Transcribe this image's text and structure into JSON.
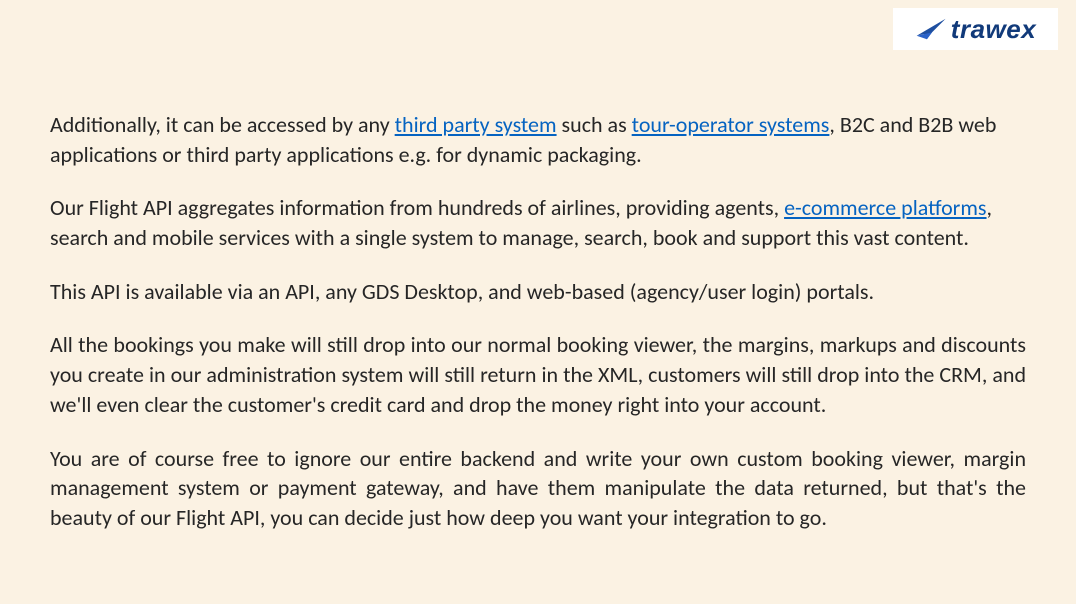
{
  "logo": {
    "brand": "trawex",
    "accent": "#113a7a"
  },
  "paragraphs": [
    {
      "justify": false,
      "segments": [
        {
          "type": "text",
          "text": "Additionally, it can be accessed by any "
        },
        {
          "type": "link",
          "text": "third party system"
        },
        {
          "type": "text",
          "text": " such as "
        },
        {
          "type": "link",
          "text": "tour-operator systems"
        },
        {
          "type": "text",
          "text": ", B2C and B2B web applications or third party applications e.g. for dynamic packaging."
        }
      ]
    },
    {
      "justify": false,
      "segments": [
        {
          "type": "text",
          "text": "Our Flight API aggregates information from hundreds of airlines, providing agents, "
        },
        {
          "type": "link",
          "text": "e-commerce platforms"
        },
        {
          "type": "text",
          "text": ", search and mobile services with a single system to manage, search, book and support this vast content."
        }
      ]
    },
    {
      "justify": false,
      "segments": [
        {
          "type": "text",
          "text": "This API is available via an API, any GDS Desktop, and web-based (agency/user login) portals."
        }
      ]
    },
    {
      "justify": true,
      "segments": [
        {
          "type": "text",
          "text": "All the bookings you make will still drop into our normal booking viewer, the margins, markups and discounts you create in our administration system will still return in the XML, customers will still drop into the CRM, and we'll even clear the customer's credit card and drop the money right into your account."
        }
      ]
    },
    {
      "justify": true,
      "segments": [
        {
          "type": "text",
          "text": "You are of course free to ignore our entire backend and write your own custom booking viewer, margin management system or payment gateway, and have them manipulate the data returned, but that's the beauty of our Flight API, you can decide just how deep you want your integration to go."
        }
      ]
    }
  ]
}
